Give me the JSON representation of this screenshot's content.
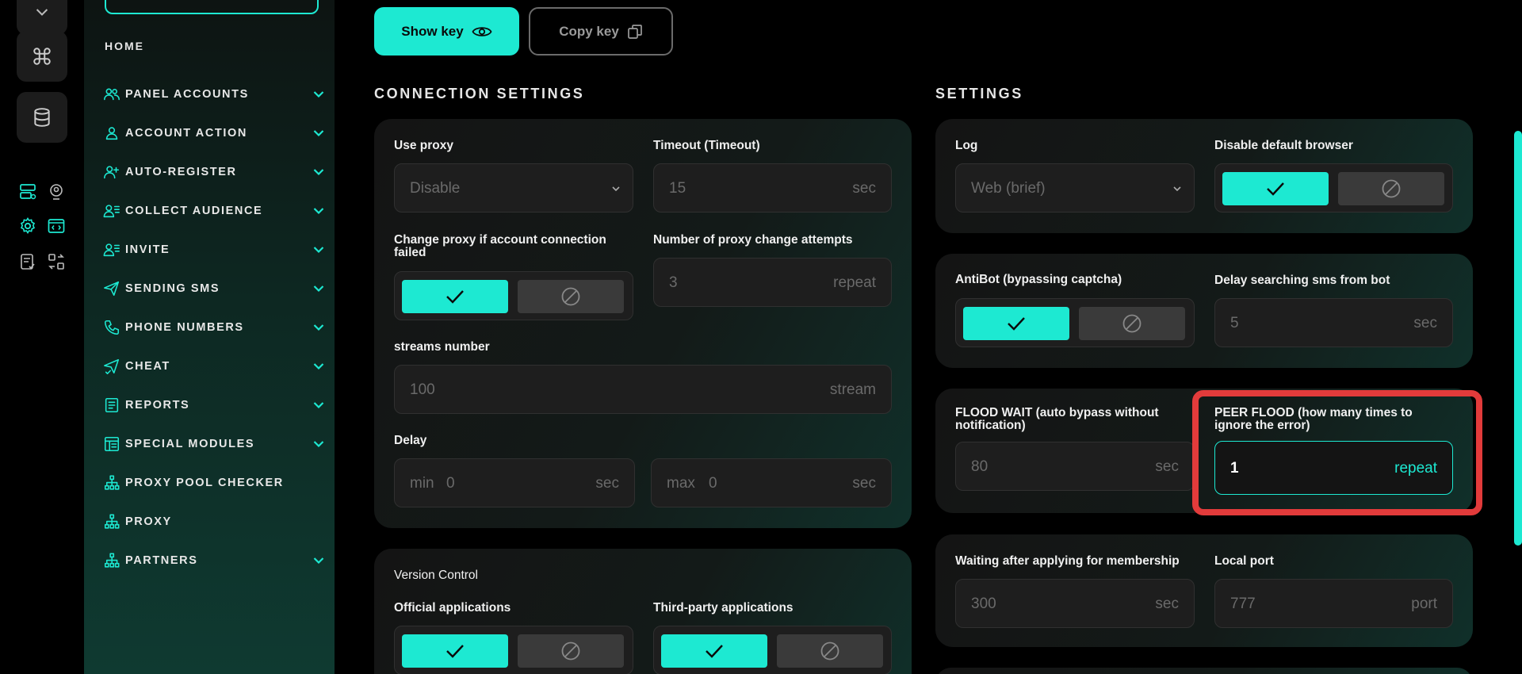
{
  "sidebar": {
    "home": "HOME",
    "items": [
      {
        "label": "PANEL ACCOUNTS",
        "icon": "users-icon",
        "chevron": true
      },
      {
        "label": "ACCOUNT ACTION",
        "icon": "user-icon",
        "chevron": true
      },
      {
        "label": "AUTO-REGISTER",
        "icon": "user-plus-icon",
        "chevron": true
      },
      {
        "label": "COLLECT AUDIENCE",
        "icon": "user-list-icon",
        "chevron": true
      },
      {
        "label": "INVITE",
        "icon": "user-list-icon",
        "chevron": true
      },
      {
        "label": "SENDING SMS",
        "icon": "send-icon",
        "chevron": true
      },
      {
        "label": "PHONE NUMBERS",
        "icon": "phone-icon",
        "chevron": true
      },
      {
        "label": "CHEAT",
        "icon": "send-check-icon",
        "chevron": true
      },
      {
        "label": "REPORTS",
        "icon": "report-icon",
        "chevron": true
      },
      {
        "label": "SPECIAL MODULES",
        "icon": "modules-icon",
        "chevron": true
      },
      {
        "label": "PROXY POOL CHECKER",
        "icon": "network-icon",
        "chevron": false
      },
      {
        "label": "PROXY",
        "icon": "network-icon",
        "chevron": false
      },
      {
        "label": "PARTNERS",
        "icon": "network-icon",
        "chevron": true
      }
    ]
  },
  "toolbar": {
    "show_key": "Show key",
    "copy_key": "Copy key"
  },
  "connection": {
    "title": "CONNECTION SETTINGS",
    "use_proxy_label": "Use proxy",
    "use_proxy_value": "Disable",
    "timeout_label": "Timeout (Timeout)",
    "timeout_value": "15",
    "timeout_unit": "sec",
    "change_proxy_label": "Change proxy if account connection failed",
    "attempts_label": "Number of proxy change attempts",
    "attempts_value": "3",
    "attempts_unit": "repeat",
    "streams_label": "streams number",
    "streams_value": "100",
    "streams_unit": "stream",
    "delay_label": "Delay",
    "delay_min_prefix": "min",
    "delay_min_value": "0",
    "delay_min_unit": "sec",
    "delay_max_prefix": "max",
    "delay_max_value": "0",
    "delay_max_unit": "sec"
  },
  "version": {
    "title": "Version Control",
    "official_label": "Official applications",
    "third_party_label": "Third-party applications"
  },
  "settings": {
    "title": "SETTINGS",
    "log_label": "Log",
    "log_value": "Web (brief)",
    "disable_browser_label": "Disable default browser",
    "antibot_label": "AntiBot (bypassing captcha)",
    "delay_sms_label": "Delay searching sms from bot",
    "delay_sms_value": "5",
    "delay_sms_unit": "sec",
    "flood_wait_label": "FLOOD WAIT (auto bypass without notification)",
    "flood_wait_value": "80",
    "flood_wait_unit": "sec",
    "peer_flood_label": "PEER FLOOD (how many times to ignore the error)",
    "peer_flood_value": "1",
    "peer_flood_unit": "repeat",
    "waiting_label": "Waiting after applying for membership",
    "waiting_value": "300",
    "waiting_unit": "sec",
    "local_port_label": "Local port",
    "local_port_value": "777",
    "local_port_unit": "port"
  },
  "colors": {
    "accent": "#1de9d2",
    "highlight": "#e23b3b"
  }
}
